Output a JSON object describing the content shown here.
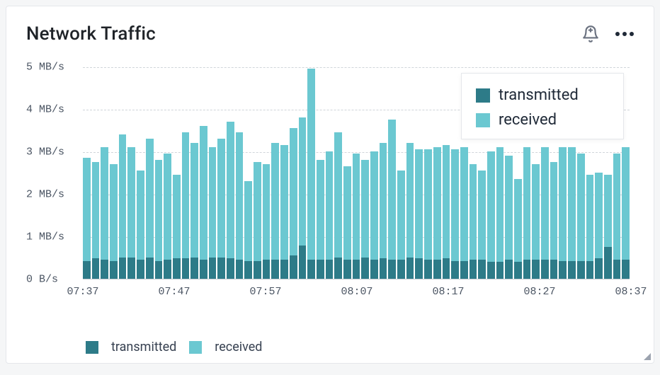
{
  "header": {
    "title": "Network Traffic"
  },
  "popup": {
    "transmitted_label": "transmitted",
    "received_label": "received"
  },
  "legend": {
    "transmitted_label": "transmitted",
    "received_label": "received"
  },
  "colors": {
    "transmitted": "#2d7b88",
    "received": "#6bc8d1"
  },
  "chart_data": {
    "type": "bar",
    "title": "Network Traffic",
    "xlabel": "",
    "ylabel": "",
    "ylim": [
      0,
      5
    ],
    "y_unit": "MB/s",
    "yticks": [
      {
        "value": 0,
        "label": "0 B/s"
      },
      {
        "value": 1,
        "label": "1 MB/s"
      },
      {
        "value": 2,
        "label": "2 MB/s"
      },
      {
        "value": 3,
        "label": "3 MB/s"
      },
      {
        "value": 4,
        "label": "4 MB/s"
      },
      {
        "value": 5,
        "label": "5 MB/s"
      }
    ],
    "xticks": [
      "07:37",
      "07:47",
      "07:57",
      "08:07",
      "08:17",
      "08:27",
      "08:37"
    ],
    "categories": [
      "07:37",
      "07:38",
      "07:39",
      "07:40",
      "07:41",
      "07:42",
      "07:43",
      "07:44",
      "07:45",
      "07:46",
      "07:47",
      "07:48",
      "07:49",
      "07:50",
      "07:51",
      "07:52",
      "07:53",
      "07:54",
      "07:55",
      "07:56",
      "07:57",
      "07:58",
      "07:59",
      "08:00",
      "08:01",
      "08:02",
      "08:03",
      "08:04",
      "08:05",
      "08:06",
      "08:07",
      "08:08",
      "08:09",
      "08:10",
      "08:11",
      "08:12",
      "08:13",
      "08:14",
      "08:15",
      "08:16",
      "08:17",
      "08:18",
      "08:19",
      "08:20",
      "08:21",
      "08:22",
      "08:23",
      "08:24",
      "08:25",
      "08:26",
      "08:27",
      "08:28",
      "08:29",
      "08:30",
      "08:31",
      "08:32",
      "08:33",
      "08:34",
      "08:35",
      "08:36",
      "08:37"
    ],
    "series": [
      {
        "name": "transmitted",
        "values": [
          0.42,
          0.48,
          0.45,
          0.42,
          0.5,
          0.5,
          0.45,
          0.5,
          0.42,
          0.45,
          0.48,
          0.48,
          0.5,
          0.45,
          0.5,
          0.5,
          0.48,
          0.45,
          0.42,
          0.42,
          0.45,
          0.45,
          0.45,
          0.55,
          0.78,
          0.45,
          0.45,
          0.45,
          0.5,
          0.45,
          0.45,
          0.5,
          0.45,
          0.48,
          0.45,
          0.45,
          0.5,
          0.48,
          0.45,
          0.45,
          0.48,
          0.42,
          0.42,
          0.45,
          0.45,
          0.4,
          0.4,
          0.45,
          0.4,
          0.45,
          0.45,
          0.45,
          0.45,
          0.42,
          0.42,
          0.42,
          0.42,
          0.48,
          0.75,
          0.45,
          0.45
        ]
      },
      {
        "name": "received",
        "values": [
          2.85,
          2.75,
          3.1,
          2.7,
          3.4,
          3.1,
          2.55,
          3.3,
          2.8,
          2.95,
          2.45,
          3.45,
          3.2,
          3.6,
          3.1,
          3.3,
          3.7,
          3.45,
          2.3,
          2.75,
          2.7,
          3.2,
          3.15,
          3.55,
          3.8,
          4.95,
          2.8,
          3.0,
          3.45,
          2.65,
          2.95,
          2.8,
          3.0,
          3.2,
          3.75,
          2.55,
          3.2,
          3.05,
          3.05,
          3.1,
          3.15,
          3.05,
          3.1,
          2.7,
          2.55,
          3.0,
          3.1,
          2.9,
          2.35,
          3.1,
          2.7,
          3.1,
          2.75,
          3.1,
          3.1,
          2.95,
          2.45,
          2.5,
          2.45,
          2.95,
          3.1
        ]
      }
    ],
    "legend_position": "bottom"
  }
}
